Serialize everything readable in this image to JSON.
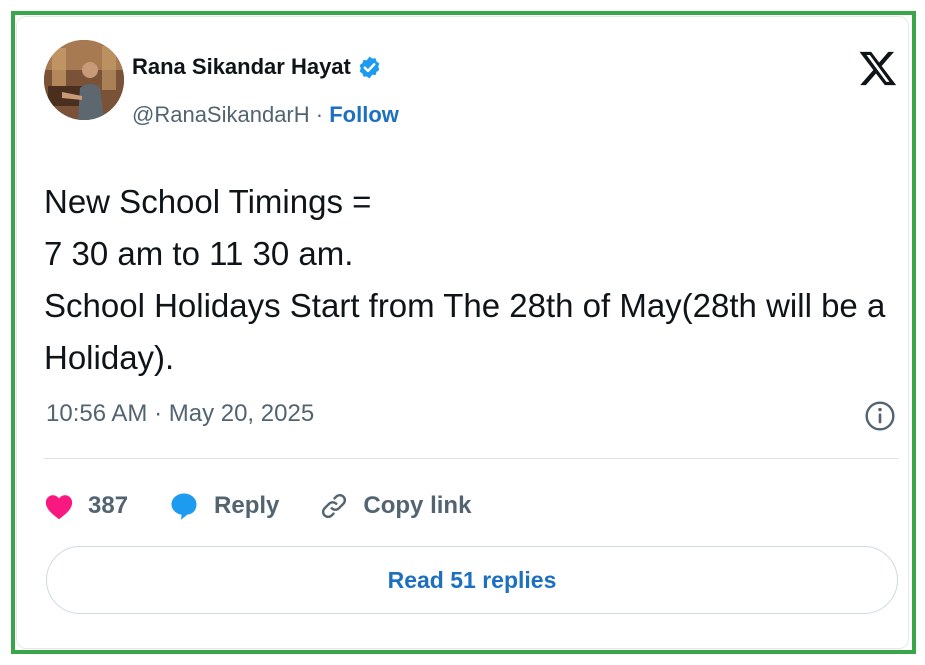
{
  "tweet": {
    "author_name": "Rana Sikandar Hayat",
    "handle": "@RanaSikandarH",
    "separator": " · ",
    "follow_label": "Follow",
    "text_lines": [
      "New School Timings =",
      "7 30 am to 11 30 am.",
      "School Holidays Start from The 28th of May(28th will be a",
      "Holiday)."
    ],
    "timestamp": "10:56 AM · May 20, 2025"
  },
  "actions": {
    "like_count": "387",
    "reply_label": "Reply",
    "copy_link_label": "Copy link"
  },
  "read_replies_label": "Read 51 replies",
  "colors": {
    "frame_border": "#3aa64a",
    "like_heart": "#f91880",
    "reply_bubble": "#1d9bf0",
    "link_blue": "#1d6fc0",
    "verified_badge": "#1d9bf0"
  },
  "icons": [
    "verified-badge-icon",
    "x-logo-icon",
    "info-icon",
    "heart-icon",
    "reply-bubble-icon",
    "link-icon"
  ]
}
